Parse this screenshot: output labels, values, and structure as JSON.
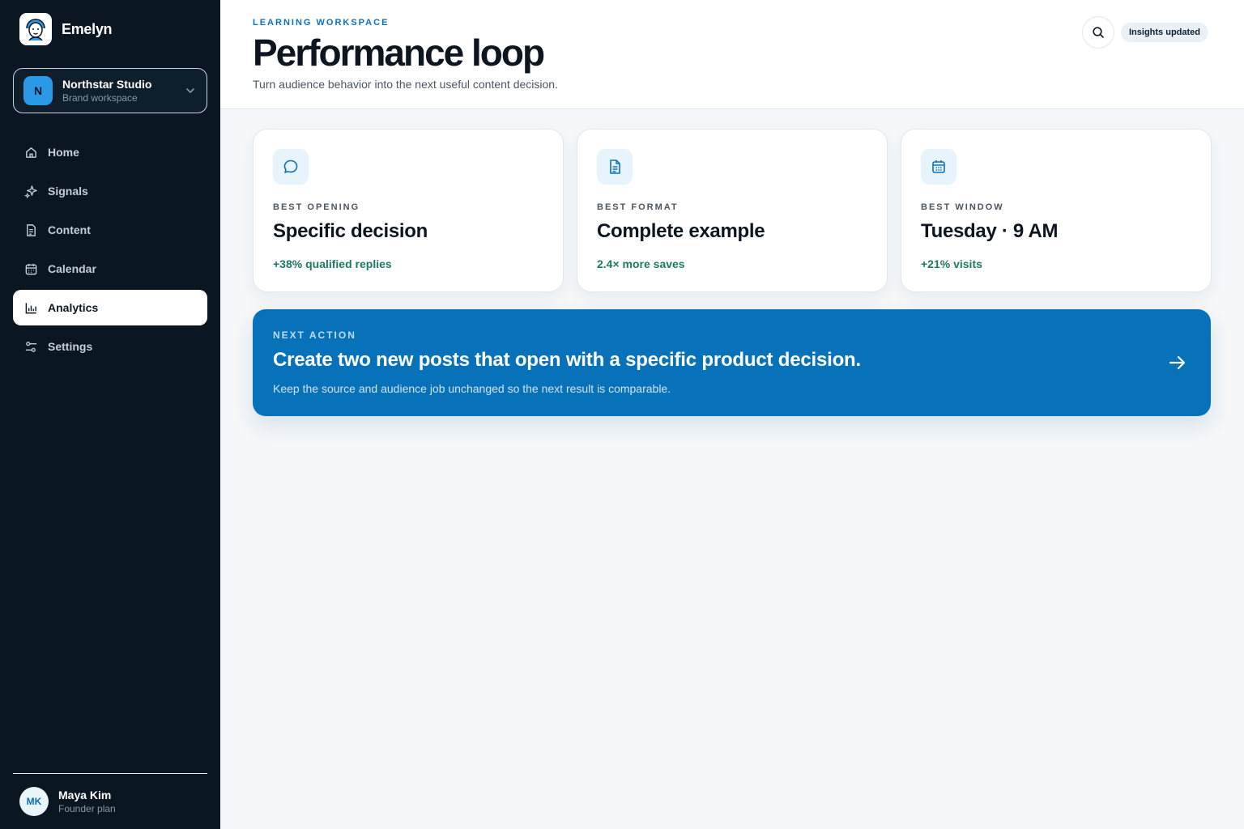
{
  "brand": {
    "name": "Emelyn"
  },
  "workspace": {
    "initial": "N",
    "name": "Northstar Studio",
    "subtitle": "Brand workspace"
  },
  "nav": {
    "items": [
      {
        "label": "Home",
        "icon": "home-icon"
      },
      {
        "label": "Signals",
        "icon": "sparkle-icon"
      },
      {
        "label": "Content",
        "icon": "document-icon"
      },
      {
        "label": "Calendar",
        "icon": "calendar-icon"
      },
      {
        "label": "Analytics",
        "icon": "bar-chart-icon",
        "active": true
      },
      {
        "label": "Settings",
        "icon": "sliders-icon"
      }
    ]
  },
  "user": {
    "initials": "MK",
    "name": "Maya Kim",
    "plan": "Founder plan"
  },
  "header": {
    "eyebrow": "LEARNING WORKSPACE",
    "title": "Performance loop",
    "subtitle": "Turn audience behavior into the next useful content decision.",
    "badge": "Insights updated"
  },
  "cards": [
    {
      "label": "BEST OPENING",
      "value": "Specific decision",
      "metric": "+38% qualified replies",
      "icon": "chat-bubble-icon"
    },
    {
      "label": "BEST FORMAT",
      "value": "Complete example",
      "metric": "2.4× more saves",
      "icon": "document-icon"
    },
    {
      "label": "BEST WINDOW",
      "value": "Tuesday · 9 AM",
      "metric": "+21% visits",
      "icon": "calendar-icon"
    }
  ],
  "action": {
    "eyebrow": "NEXT ACTION",
    "title": "Create two new posts that open with a specific product decision.",
    "subtitle": "Keep the source and audience job unchanged so the next result is comparable."
  },
  "colors": {
    "sidebar": "#0a1722",
    "accent": "#0772ba",
    "metric": "#1a7a63",
    "background": "#f5f7f9"
  }
}
